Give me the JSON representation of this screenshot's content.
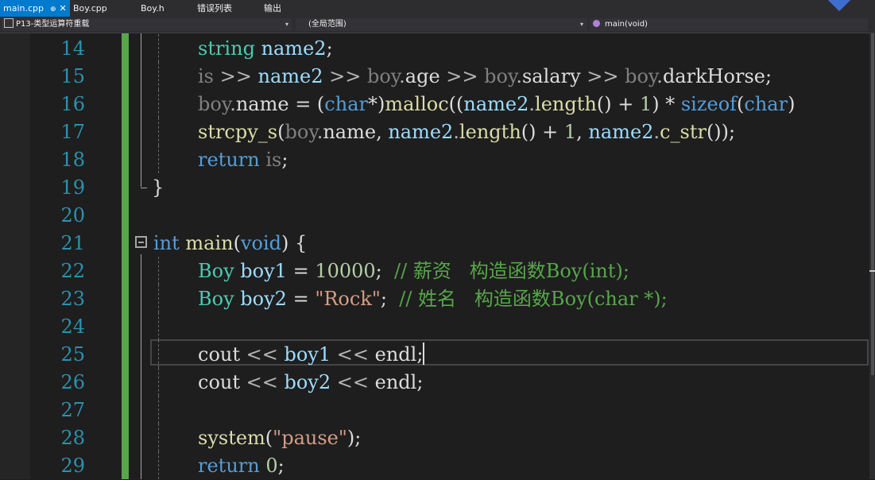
{
  "tabs": [
    {
      "label": "main.cpp",
      "active": true,
      "pin": "⊕",
      "close": "✕"
    },
    {
      "label": "Boy.cpp",
      "active": false
    },
    {
      "label": "Boy.h",
      "active": false
    },
    {
      "label": "错误列表",
      "active": false
    },
    {
      "label": "输出",
      "active": false
    }
  ],
  "navigation": {
    "project": "P13-类型运算符重载",
    "scope": "(全局范围)",
    "member": "main(void)",
    "dropdown_arrow": "▾"
  },
  "editor": {
    "line_numbers": [
      "14",
      "15",
      "16",
      "17",
      "18",
      "19",
      "20",
      "21",
      "22",
      "23",
      "24",
      "25",
      "26",
      "27",
      "28",
      "29"
    ],
    "lines": {
      "l14": {
        "t1": "string",
        "t2": " ",
        "t3": "name2",
        "t4": ";"
      },
      "l15": {
        "t1": "is",
        "t2": " >> ",
        "t3": "name2",
        "t4": " >> ",
        "t5": "boy",
        "t6": ".",
        "t7": "age",
        "t8": " >> ",
        "t9": "boy",
        "t10": ".",
        "t11": "salary",
        "t12": " >> ",
        "t13": "boy",
        "t14": ".",
        "t15": "darkHorse",
        "t16": ";"
      },
      "l16": {
        "t1": "boy",
        "t2": ".",
        "t3": "name",
        "t4": " = (",
        "t5": "char",
        "t6": "*)",
        "t7": "malloc",
        "t8": "((",
        "t9": "name2",
        "t10": ".",
        "t11": "length",
        "t12": "() + ",
        "t13": "1",
        "t14": ") * ",
        "t15": "sizeof",
        "t16": "(",
        "t17": "char",
        "t18": ")"
      },
      "l17": {
        "t1": "strcpy_s",
        "t2": "(",
        "t3": "boy",
        "t4": ".",
        "t5": "name",
        "t6": ", ",
        "t7": "name2",
        "t8": ".",
        "t9": "length",
        "t10": "() + ",
        "t11": "1",
        "t12": ", ",
        "t13": "name2",
        "t14": ".",
        "t15": "c_str",
        "t16": "());"
      },
      "l18": {
        "t1": "return",
        "t2": " ",
        "t3": "is",
        "t4": ";"
      },
      "l19": {
        "t1": "}"
      },
      "l21": {
        "t1": "int",
        "t2": " ",
        "t3": "main",
        "t4": "(",
        "t5": "void",
        "t6": ") {"
      },
      "l22": {
        "t1": "Boy",
        "t2": " ",
        "t3": "boy1",
        "t4": " = ",
        "t5": "10000",
        "t6": ";  ",
        "t7": "// 薪资   构造函数Boy(int);"
      },
      "l23": {
        "t1": "Boy",
        "t2": " ",
        "t3": "boy2",
        "t4": " = ",
        "t5": "\"Rock\"",
        "t6": ";  ",
        "t7": "// 姓名   构造函数Boy(char *);"
      },
      "l25": {
        "t1": "cout",
        "t2": " << ",
        "t3": "boy1",
        "t4": " << ",
        "t5": "endl",
        "t6": ";"
      },
      "l26": {
        "t1": "cout",
        "t2": " << ",
        "t3": "boy2",
        "t4": " << ",
        "t5": "endl",
        "t6": ";"
      },
      "l28": {
        "t1": "system",
        "t2": "(",
        "t3": "\"pause\"",
        "t4": ");"
      },
      "l29": {
        "t1": "return",
        "t2": " ",
        "t3": "0",
        "t4": ";"
      }
    }
  },
  "colors": {
    "background": "#1e1e1e",
    "line_number": "#2b91af",
    "keyword": "#569cd6",
    "type": "#4ec9b0",
    "function": "#dcdcaa",
    "variable": "#9cdcfe",
    "number": "#b5cea8",
    "string": "#d69d85",
    "comment": "#57a64a",
    "active_tab": "#007acc",
    "change_bar": "#57a64a"
  }
}
